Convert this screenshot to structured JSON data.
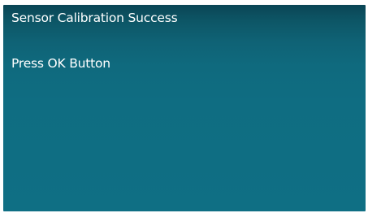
{
  "screen": {
    "title": "Sensor Calibration Success",
    "instruction": "Press OK Button"
  },
  "colors": {
    "background_top": "#0a4555",
    "background_bottom": "#0f6f84",
    "text": "#ffffff"
  }
}
